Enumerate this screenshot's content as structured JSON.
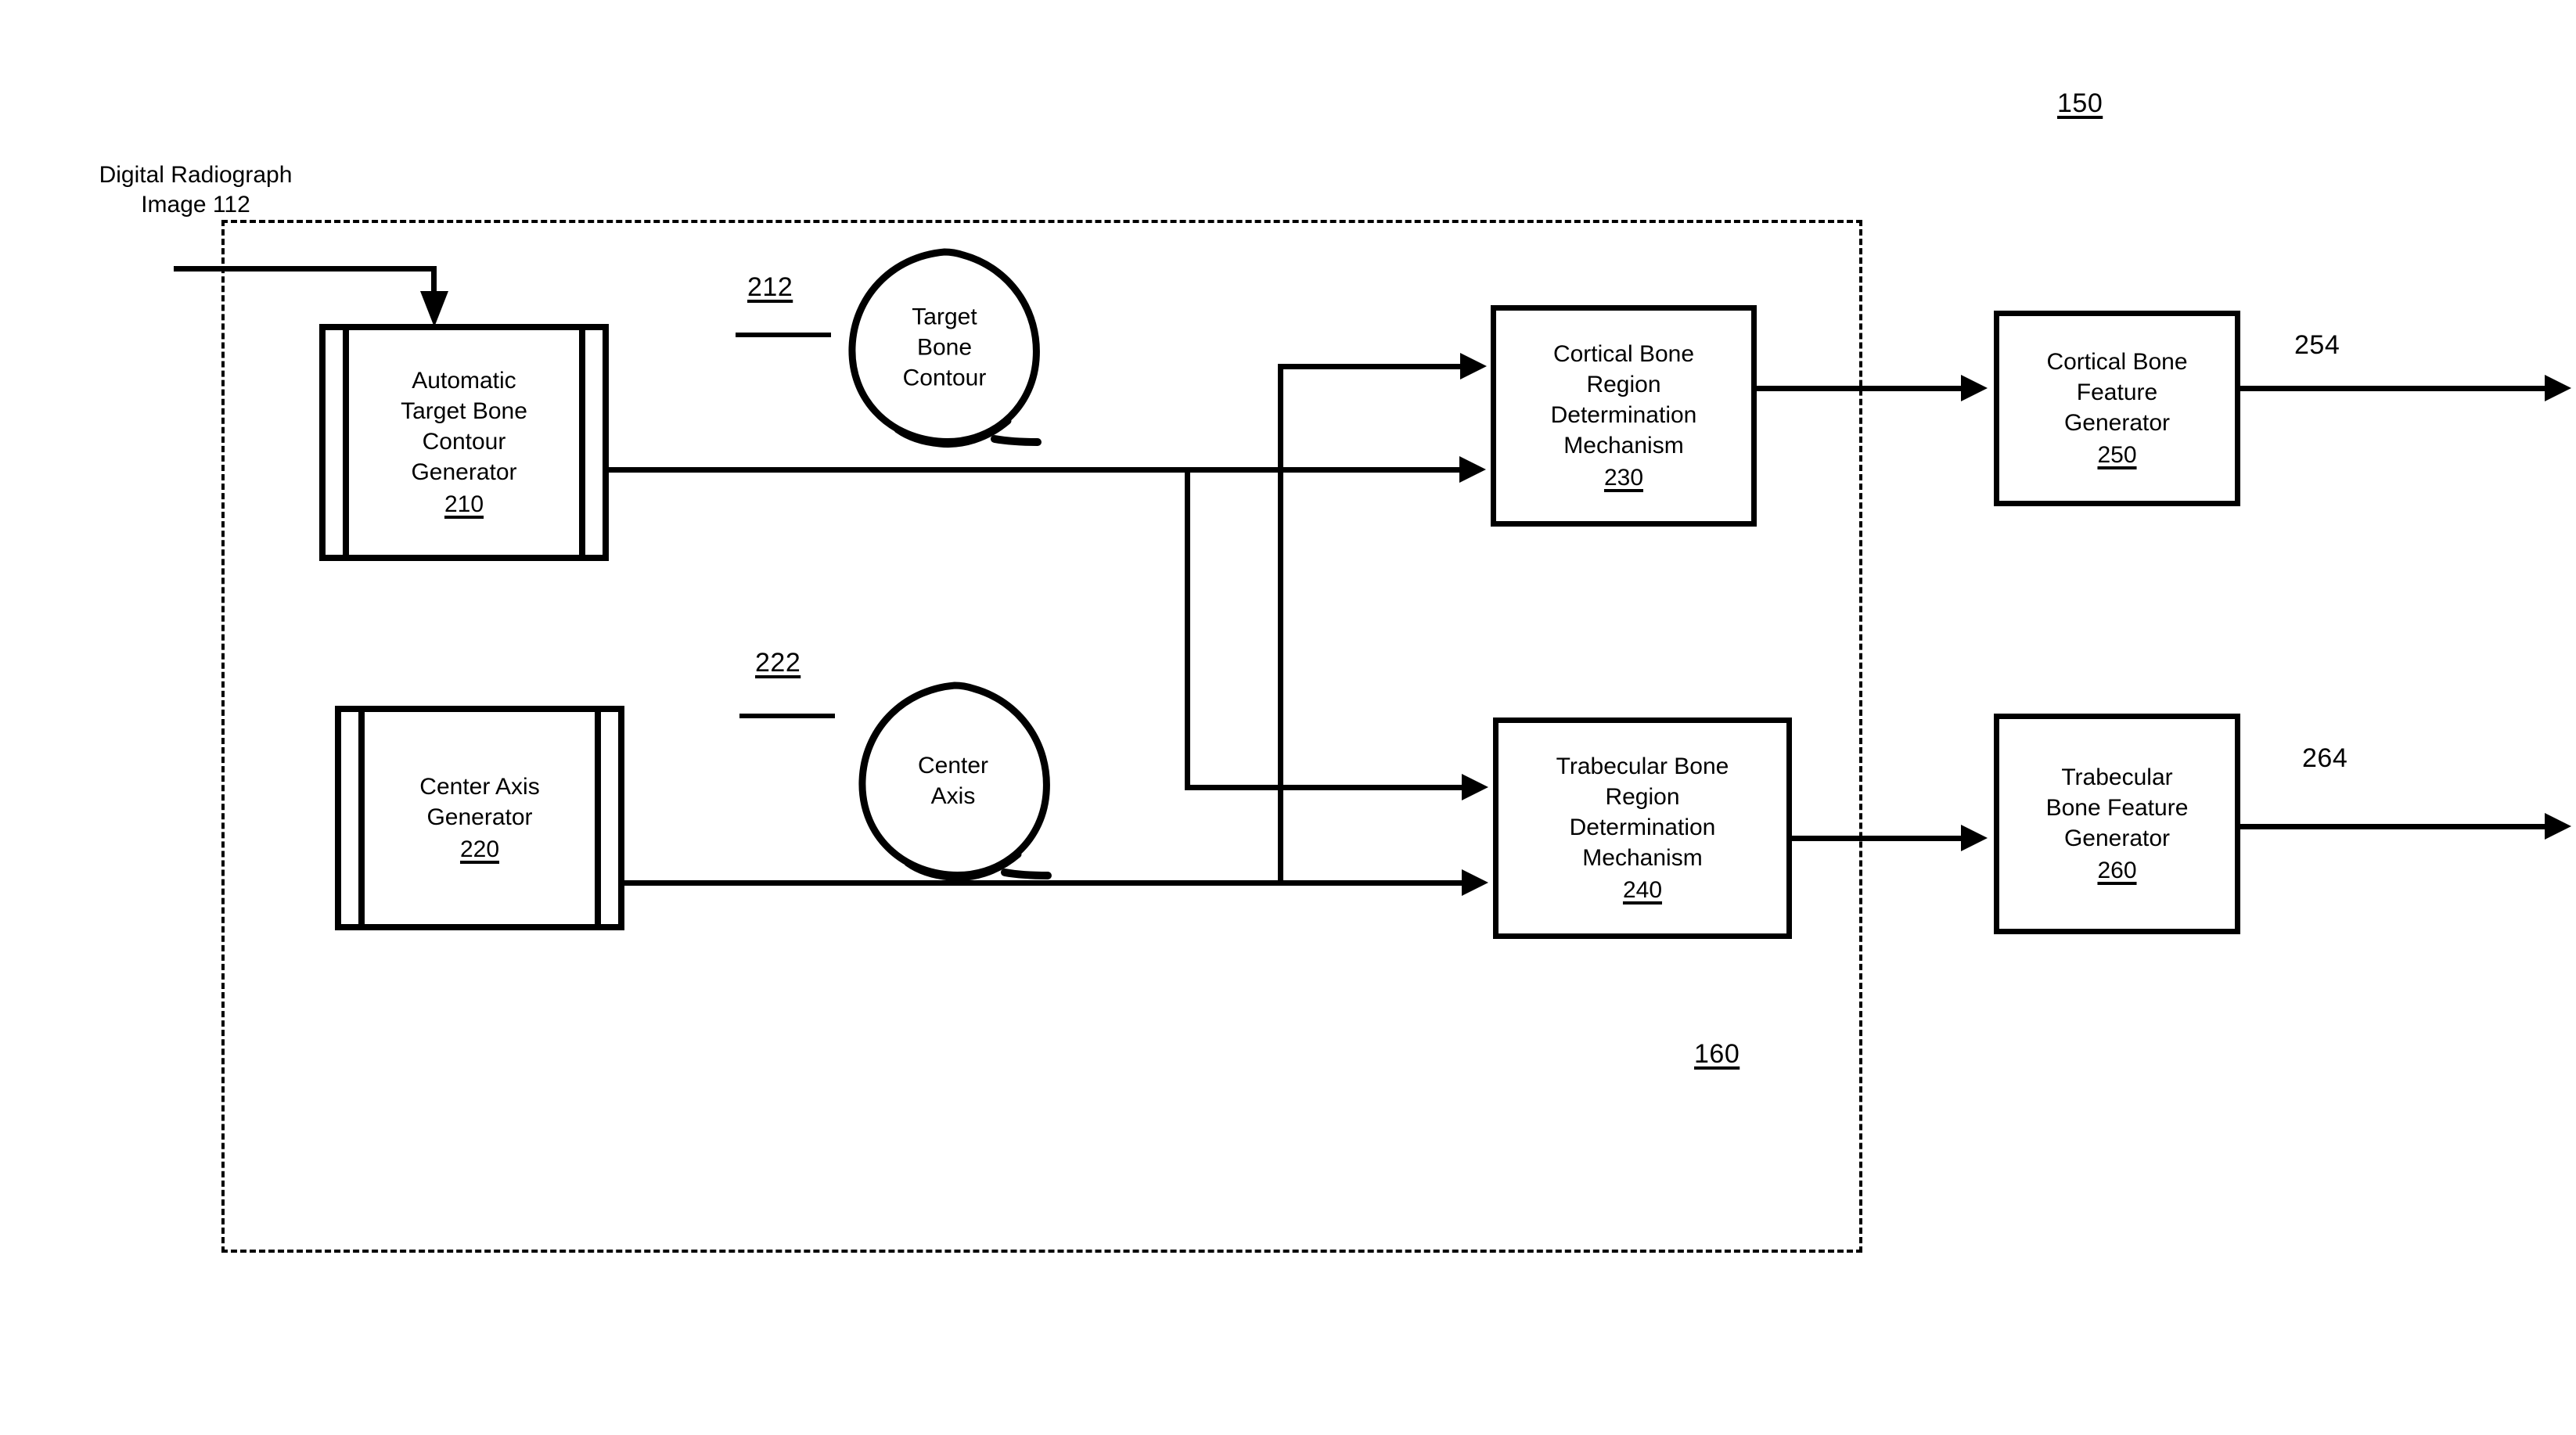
{
  "figure": {
    "top_ref": "150",
    "region_ref": "160",
    "input_label": "Digital Radiograph\nImage 112"
  },
  "modules": [
    {
      "id": "atbcg",
      "text": "Automatic\nTarget Bone\nContour\nGenerator",
      "num": "210"
    },
    {
      "id": "cag",
      "text": "Center Axis\nGenerator",
      "num": "220"
    }
  ],
  "bubbles": [
    {
      "id": "target-bone-contour",
      "text": "Target\nBone\nContour",
      "ref": "212"
    },
    {
      "id": "center-axis",
      "text": "Center\nAxis",
      "ref": "222"
    }
  ],
  "mechanisms": [
    {
      "id": "cortical-region",
      "text": "Cortical Bone\nRegion\nDetermination\nMechanism",
      "num": "230"
    },
    {
      "id": "trabecular-region",
      "text": "Trabecular Bone\nRegion\nDetermination\nMechanism",
      "num": "240"
    }
  ],
  "generators": [
    {
      "id": "cortical-feature",
      "text": "Cortical Bone\nFeature\nGenerator",
      "num": "250",
      "output_ref": "254"
    },
    {
      "id": "trabecular-feature",
      "text": "Trabecular\nBone Feature\nGenerator",
      "num": "260",
      "output_ref": "264"
    }
  ],
  "colors": {
    "ink": "#000000",
    "paper": "#ffffff"
  }
}
